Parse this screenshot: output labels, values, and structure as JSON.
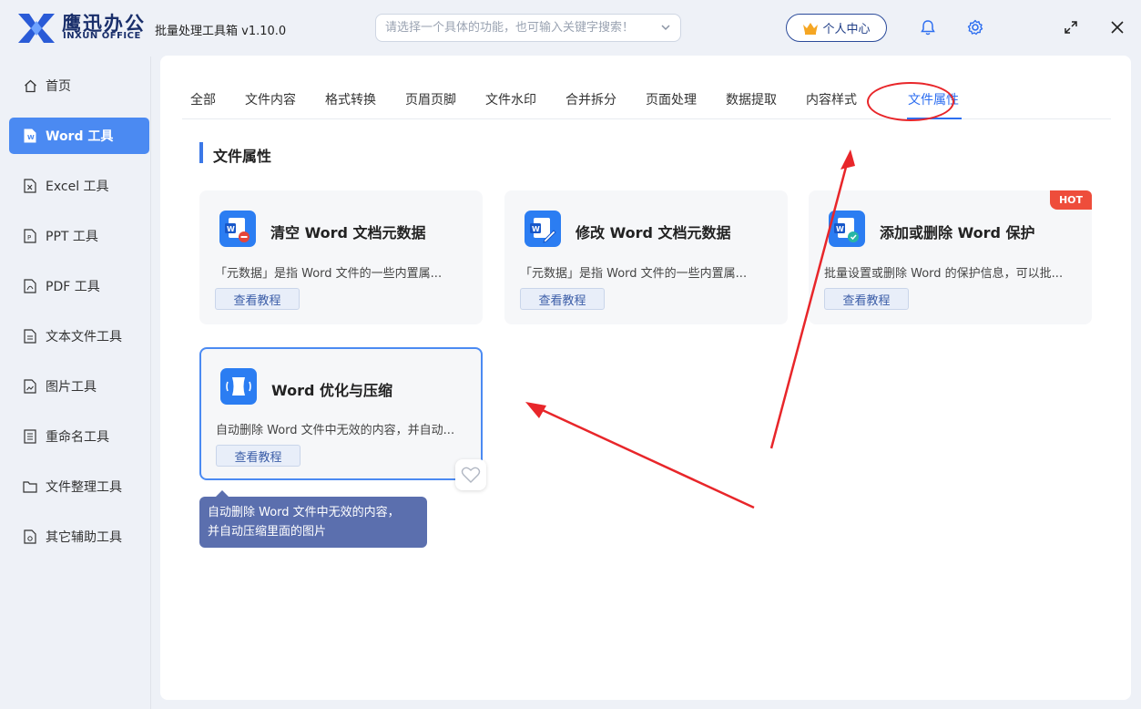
{
  "header": {
    "brand_cn": "鹰迅办公",
    "brand_en": "INXUN OFFICE",
    "app_title": "批量处理工具箱 v1.10.0",
    "search_placeholder": "请选择一个具体的功能，也可输入关键字搜索！",
    "user_center_label": "个人中心"
  },
  "sidebar": {
    "items": [
      {
        "label": "首页",
        "icon": "home-icon"
      },
      {
        "label": "Word 工具",
        "icon": "word-file-icon",
        "active": true
      },
      {
        "label": "Excel 工具",
        "icon": "excel-file-icon"
      },
      {
        "label": "PPT 工具",
        "icon": "ppt-file-icon"
      },
      {
        "label": "PDF 工具",
        "icon": "pdf-file-icon"
      },
      {
        "label": "文本文件工具",
        "icon": "text-file-icon"
      },
      {
        "label": "图片工具",
        "icon": "image-file-icon"
      },
      {
        "label": "重命名工具",
        "icon": "rename-icon"
      },
      {
        "label": "文件整理工具",
        "icon": "folder-icon"
      },
      {
        "label": "其它辅助工具",
        "icon": "misc-tools-icon"
      }
    ]
  },
  "tabs": [
    {
      "label": "全部"
    },
    {
      "label": "文件内容"
    },
    {
      "label": "格式转换"
    },
    {
      "label": "页眉页脚"
    },
    {
      "label": "文件水印"
    },
    {
      "label": "合并拆分"
    },
    {
      "label": "页面处理"
    },
    {
      "label": "数据提取"
    },
    {
      "label": "内容样式"
    },
    {
      "label": "文件属性",
      "active": true
    }
  ],
  "section": {
    "title": "文件属性"
  },
  "cards": [
    {
      "title": "清空 Word 文档元数据",
      "desc": "「元数据」是指 Word 文件的一些内置属...",
      "button": "查看教程"
    },
    {
      "title": "修改 Word 文档元数据",
      "desc": "「元数据」是指 Word 文件的一些内置属...",
      "button": "查看教程"
    },
    {
      "title": "添加或删除 Word 保护",
      "desc": "批量设置或删除 Word 的保护信息，可以批...",
      "button": "查看教程",
      "badge": "HOT"
    },
    {
      "title": "Word 优化与压缩",
      "desc": "自动删除 Word 文件中无效的内容，并自动...",
      "button": "查看教程"
    }
  ],
  "tooltip": {
    "line1": "自动删除 Word 文件中无效的内容，",
    "line2": "并自动压缩里面的图片"
  },
  "colors": {
    "accent": "#4b8af2",
    "tab_active": "#2d6ef0",
    "annotation_red": "#e8262a",
    "hot_badge": "#ee4d3b"
  }
}
